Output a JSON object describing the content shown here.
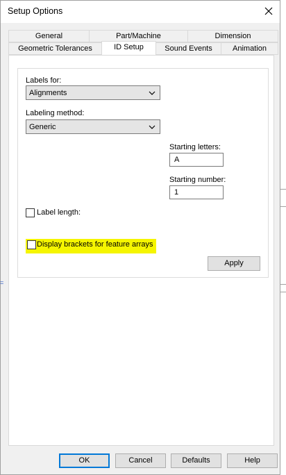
{
  "window": {
    "title": "Setup Options",
    "close_icon": "close-icon"
  },
  "tabs_row1": [
    "General",
    "Part/Machine",
    "Dimension"
  ],
  "tabs_row2": [
    "Geometric Tolerances",
    "ID Setup",
    "Sound Events",
    "Animation"
  ],
  "active_tab": "ID Setup",
  "panel": {
    "labels_for": {
      "label": "Labels for:",
      "value": "Alignments"
    },
    "labeling_method": {
      "label": "Labeling method:",
      "value": "Generic"
    },
    "starting_letters": {
      "label": "Starting letters:",
      "value": "A"
    },
    "starting_number": {
      "label": "Starting number:",
      "value": "1"
    },
    "label_length": {
      "label": "Label length:",
      "checked": false
    },
    "display_brackets": {
      "label": "Display brackets for feature arrays",
      "checked": false,
      "highlight_color": "#f5f500"
    },
    "apply_label": "Apply"
  },
  "footer": {
    "ok_label": "OK",
    "cancel_label": "Cancel",
    "defaults_label": "Defaults",
    "help_label": "Help"
  },
  "left_mark": "="
}
